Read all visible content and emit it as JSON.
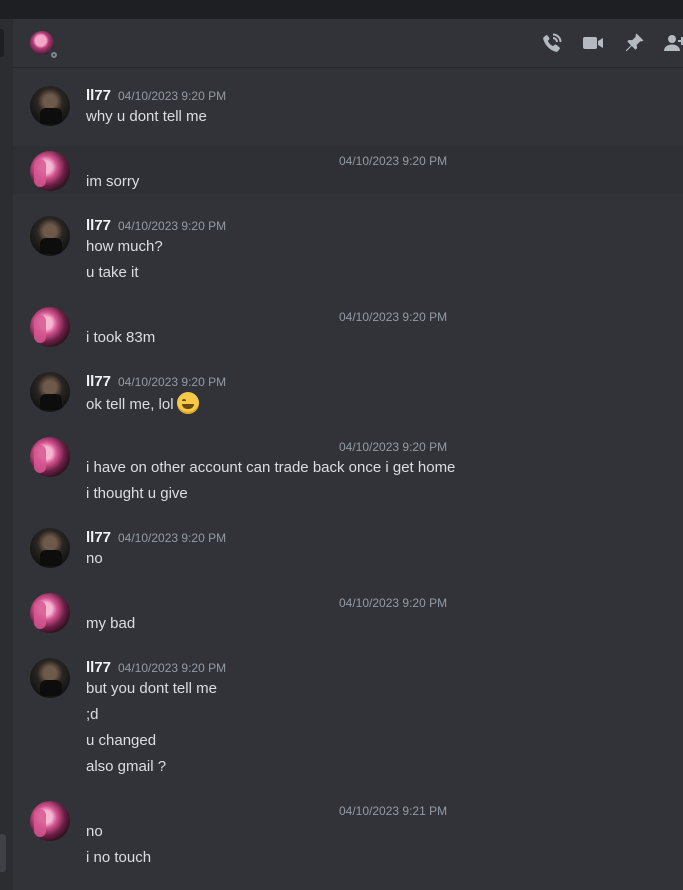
{
  "header": {
    "tools": [
      {
        "icon": "phone-call-icon"
      },
      {
        "icon": "video-camera-icon"
      },
      {
        "icon": "pin-icon"
      },
      {
        "icon": "add-friend-icon"
      }
    ]
  },
  "messages": [
    {
      "author": "ll77",
      "timestamp": "04/10/2023 9:20 PM",
      "lines": [
        "why u dont tell me"
      ]
    },
    {
      "author": "",
      "timestamp": "04/10/2023 9:20 PM",
      "lines": [
        "im sorry"
      ]
    },
    {
      "author": "ll77",
      "timestamp": "04/10/2023 9:20 PM",
      "lines": [
        "how much?",
        "u take it"
      ]
    },
    {
      "author": "",
      "timestamp": "04/10/2023 9:20 PM",
      "lines": [
        "i took 83m"
      ]
    },
    {
      "author": "ll77",
      "timestamp": "04/10/2023 9:20 PM",
      "lines": [
        "ok tell me, lol"
      ],
      "emoji": "grinning-face-icon"
    },
    {
      "author": "",
      "timestamp": "04/10/2023 9:20 PM",
      "lines": [
        "i have on other account can trade back once i get home",
        "i thought u give"
      ]
    },
    {
      "author": "ll77",
      "timestamp": "04/10/2023 9:20 PM",
      "lines": [
        "no"
      ]
    },
    {
      "author": "",
      "timestamp": "04/10/2023 9:20 PM",
      "lines": [
        "my bad"
      ]
    },
    {
      "author": "ll77",
      "timestamp": "04/10/2023 9:20 PM",
      "lines": [
        "but you dont tell me",
        ";d",
        "u changed",
        "also gmail ?"
      ]
    },
    {
      "author": "",
      "timestamp": "04/10/2023 9:21 PM",
      "lines": [
        "no",
        "i no touch"
      ]
    }
  ],
  "colors": {
    "background": "#313338",
    "text": "#dbdee1",
    "username": "#f2f3f5",
    "timestamp": "#949ba4"
  }
}
